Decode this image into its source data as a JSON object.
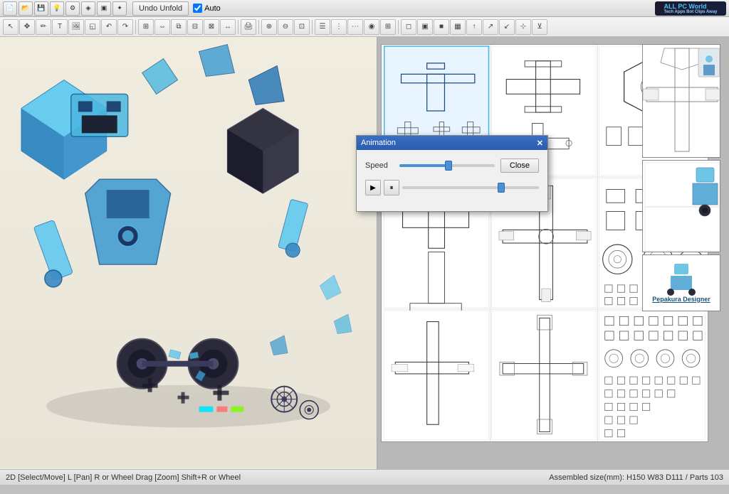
{
  "titlebar": {
    "undo_unfold_label": "Undo Unfold",
    "auto_label": "Auto",
    "logo_text": "ALL PC World",
    "logo_subtext": "Tech Apps Bot Clips Away"
  },
  "toolbar": {
    "buttons": [
      {
        "name": "new",
        "icon": "📄"
      },
      {
        "name": "open",
        "icon": "📂"
      },
      {
        "name": "save",
        "icon": "💾"
      },
      {
        "name": "light",
        "icon": "💡"
      },
      {
        "name": "settings1",
        "icon": "⚙"
      },
      {
        "name": "settings2",
        "icon": "⚙"
      },
      {
        "name": "settings3",
        "icon": "◈"
      },
      {
        "name": "settings4",
        "icon": "✦"
      },
      {
        "name": "cursor",
        "icon": "↖"
      },
      {
        "name": "move",
        "icon": "✥"
      },
      {
        "name": "unfold",
        "icon": "◱"
      },
      {
        "name": "paint",
        "icon": "✏"
      },
      {
        "name": "arrow-left",
        "icon": "↶"
      },
      {
        "name": "arrow-right",
        "icon": "↷"
      },
      {
        "name": "select-all",
        "icon": "⬛"
      },
      {
        "name": "flip",
        "icon": "⇔"
      },
      {
        "name": "stack",
        "icon": "⧉"
      },
      {
        "name": "align",
        "icon": "⊞"
      },
      {
        "name": "distribute",
        "icon": "⊟"
      },
      {
        "name": "scale",
        "icon": "⊠"
      },
      {
        "name": "print",
        "icon": "🖨"
      },
      {
        "name": "zoom-in",
        "icon": "⊕"
      },
      {
        "name": "zoom-out",
        "icon": "⊖"
      },
      {
        "name": "zoom-fit",
        "icon": "⊡"
      },
      {
        "name": "layers",
        "icon": "☰"
      },
      {
        "name": "split",
        "icon": "⋮"
      },
      {
        "name": "join",
        "icon": "⋯"
      },
      {
        "name": "explode",
        "icon": "⊹"
      },
      {
        "name": "color",
        "icon": "◉"
      },
      {
        "name": "wireframe",
        "icon": "⊞"
      },
      {
        "name": "solid",
        "icon": "■"
      },
      {
        "name": "texture",
        "icon": "▦"
      },
      {
        "name": "edge-show",
        "icon": "◻"
      },
      {
        "name": "edge-hide",
        "icon": "▣"
      }
    ]
  },
  "animation_dialog": {
    "title": "Animation",
    "speed_label": "Speed",
    "close_button": "Close",
    "speed_value": 50,
    "progress_value": 70
  },
  "statusbar": {
    "left_text": "2D [Select/Move] L [Pan] R or Wheel Drag [Zoom] Shift+R or Wheel",
    "right_text": "Assembled size(mm): H150 W83 D111 / Parts 103"
  },
  "brand": {
    "name": "Pepakura Designer"
  },
  "viewport": {
    "hint": "3D Model Viewport - Blue Robot Unfolded"
  },
  "paper": {
    "hint": "2D Paper Layout"
  }
}
